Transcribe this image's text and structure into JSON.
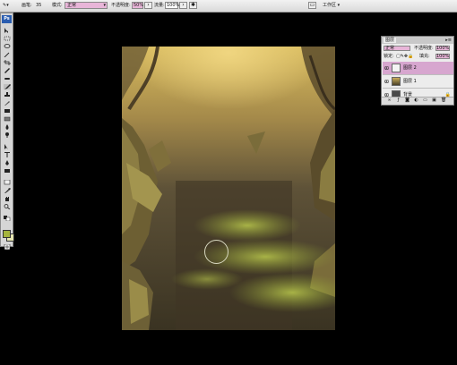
{
  "options_bar": {
    "brush_label": "画笔:",
    "brush_size": "35",
    "mode_label": "模式:",
    "mode_value": "正常",
    "opacity_label": "不透明度:",
    "opacity_value": "50%",
    "flow_label": "流量:",
    "flow_value": "100%",
    "workspace_label": "工作区"
  },
  "toolbar": {
    "logo": "Ps",
    "foreground_color": "#a5b43c",
    "background_color": "#e6e6b0"
  },
  "layers_panel": {
    "tab_label": "图层",
    "blend_mode": "正常",
    "opacity_label": "不透明度:",
    "opacity_value": "100%",
    "lock_label": "锁定:",
    "fill_label": "填充:",
    "fill_value": "100%",
    "layers": [
      {
        "name": "图层 2",
        "active": true
      },
      {
        "name": "图层 1",
        "active": false
      },
      {
        "name": "背景",
        "active": false
      }
    ]
  }
}
